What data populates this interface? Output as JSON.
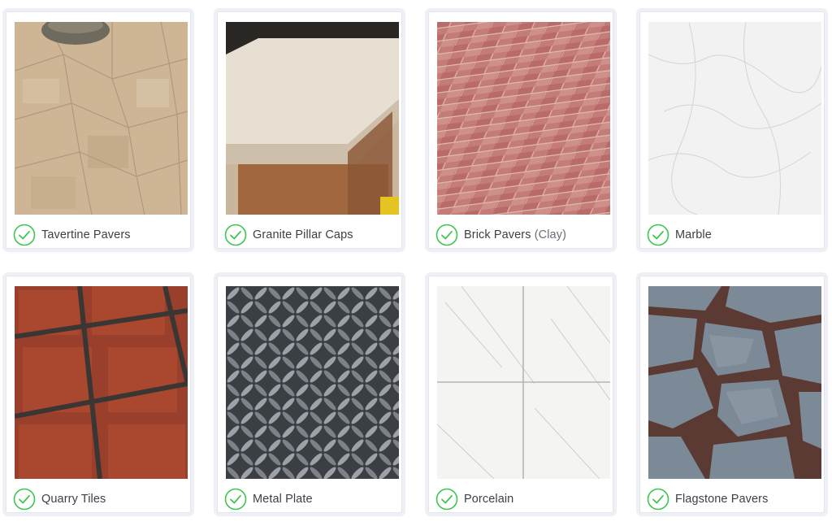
{
  "products": [
    {
      "name": "Tavertine Pavers",
      "image": "travertine-pavers-photo"
    },
    {
      "name": "Granite Pillar Caps",
      "image": "granite-pillar-cap-photo"
    },
    {
      "name": "Brick Pavers",
      "name_suffix": "(Clay)",
      "image": "brick-pavers-photo"
    },
    {
      "name": "Marble",
      "image": "marble-photo"
    },
    {
      "name": "Quarry Tiles",
      "image": "quarry-tiles-photo"
    },
    {
      "name": "Metal Plate",
      "image": "metal-plate-photo"
    },
    {
      "name": "Porcelain",
      "image": "porcelain-photo"
    },
    {
      "name": "Flagstone Pavers",
      "image": "flagstone-pavers-photo"
    }
  ],
  "icons": {
    "check": "check-circle-icon"
  },
  "colors": {
    "check_green": "#3ec54d",
    "label_text": "#3c3f47",
    "card_border": "#e4e6ec"
  }
}
